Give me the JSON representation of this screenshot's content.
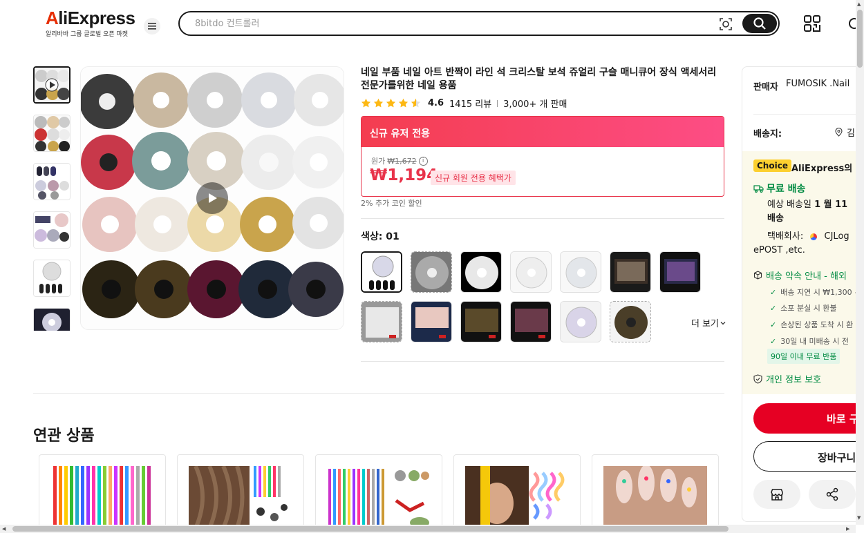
{
  "header": {
    "logo_text": "AliExpress",
    "logo_sub": "알리바바 그룹 글로벌 오픈 마켓",
    "search_placeholder": "8bitdo 컨트롤러"
  },
  "product": {
    "title": "네일 부품 네일 아트 반짝이 라인 석 크리스탈 보석 쥬얼리 구슬 매니큐어 장식 액세서리 전문가를위한 네일 용품",
    "rating": "4.6",
    "reviews": "1415 리뷰",
    "sold": "3,000+ 개 판매",
    "stars_filled": 4.5
  },
  "promo": {
    "header": "신규 유저 전용",
    "original_label": "원가",
    "original_price": "₩1,672",
    "price": "₩1,194",
    "tag": "신규 회원 전용 혜택가",
    "coin_note": "2% 추가 코인 할인"
  },
  "variant": {
    "label": "색상: 01",
    "more_label": "더 보기"
  },
  "related": {
    "title": "연관 상품"
  },
  "sidebar": {
    "seller_label": "판매자",
    "seller_name": "FUMOSIK .Nail",
    "ship_label": "배송지:",
    "ship_location": "김",
    "choice_badge": "Choice",
    "choice_text": "AliExpress의 약",
    "free_shipping": "무료 배송",
    "eta_line1_prefix": "예상 배송일 ",
    "eta_line1_bold": "1 월 11",
    "eta_line2": "배송",
    "courier_line1": "택배회사:",
    "courier_name": "CJLog",
    "courier_line2": "ePOST ,etc.",
    "promise_title": "배송 약속 안내 - 해외",
    "promise_items": [
      "배송 지연 시 ₩1,300 ~",
      "소포 분실 시 환불",
      "손상된 상품 도착 시 환",
      "30일 내 미배송 시 전"
    ],
    "return_badge": "90일 이내 무료 반품",
    "privacy": "개인 정보 보호",
    "buy_now": "바로 구",
    "add_to_cart": "장바구니"
  },
  "colors": {
    "brand_red": "#e62e04",
    "price_red": "#e8334a",
    "green": "#018b42",
    "choice_yellow": "#fcd02f"
  }
}
